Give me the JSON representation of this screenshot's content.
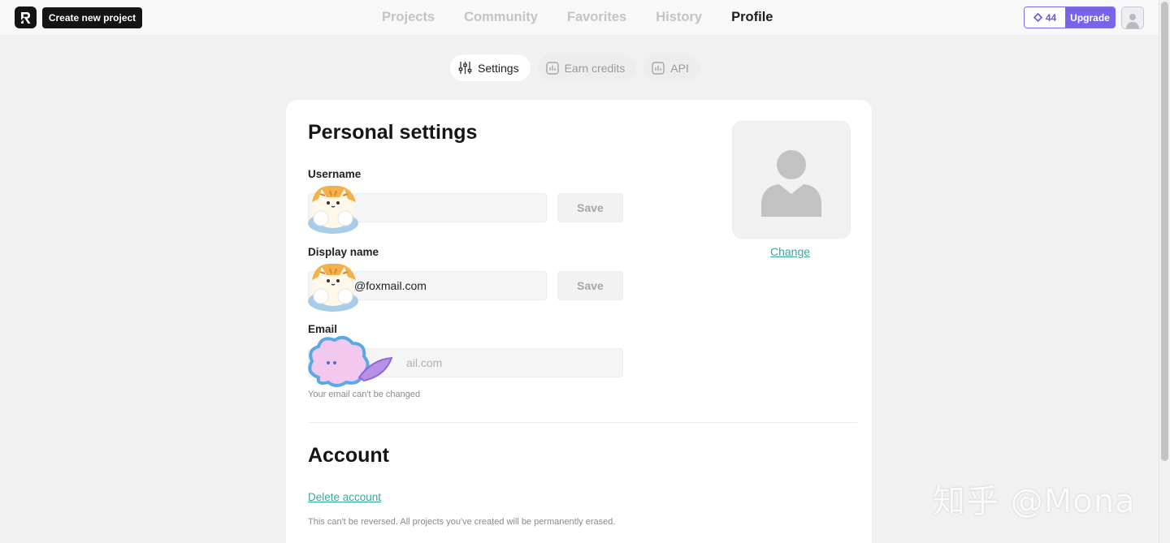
{
  "header": {
    "create_label": "Create new project",
    "nav": [
      "Projects",
      "Community",
      "Favorites",
      "History",
      "Profile"
    ],
    "active_nav": "Profile",
    "credits": "44",
    "upgrade_label": "Upgrade"
  },
  "subtabs": [
    {
      "label": "Settings",
      "icon": "sliders-icon",
      "active": true
    },
    {
      "label": "Earn credits",
      "icon": "chart-icon",
      "active": false
    },
    {
      "label": "API",
      "icon": "chart-icon",
      "active": false
    }
  ],
  "personal": {
    "title": "Personal settings",
    "username_label": "Username",
    "username_value": "",
    "display_label": "Display name",
    "display_value": "@foxmail.com",
    "email_label": "Email",
    "email_value": "ail.com",
    "email_helper": "Your email can't be changed",
    "save_label": "Save",
    "change_label": "Change"
  },
  "account": {
    "title": "Account",
    "delete_label": "Delete account",
    "warning": "This can't be reversed. All projects you've created will be permanently erased."
  },
  "watermark": "知乎 @Mona",
  "colors": {
    "accent": "#7a63e8",
    "link": "#3aa79b",
    "dark": "#141414"
  }
}
